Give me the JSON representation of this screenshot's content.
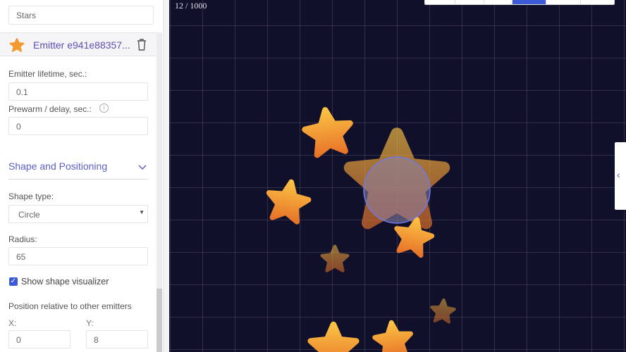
{
  "sidebar": {
    "name_value": "Stars",
    "emitter_title": "Emitter e941e88357...",
    "lifetime_label": "Emitter lifetime, sec.:",
    "lifetime_value": "0.1",
    "prewarm_label": "Prewarm / delay, sec.:",
    "prewarm_value": "0",
    "section_title": "Shape and Positioning",
    "shape_type_label": "Shape type:",
    "shape_type_value": "Circle",
    "radius_label": "Radius:",
    "radius_value": "65",
    "show_visualizer_label": "Show shape visualizer",
    "show_visualizer_checked": true,
    "position_label": "Position relative to other emitters",
    "x_label": "X:",
    "x_value": "0",
    "y_label": "Y:",
    "y_value": "8"
  },
  "canvas": {
    "particle_counter": "12 / 1000",
    "toolbar_active_index": 3,
    "accent": "#3d5bd9",
    "background": "#11102b"
  }
}
